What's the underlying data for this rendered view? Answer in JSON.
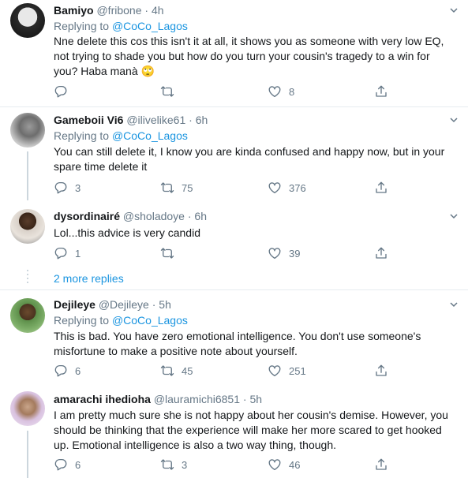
{
  "replying_label": "Replying to",
  "tweets": [
    {
      "name": "Bamiyo",
      "handle": "@fribone",
      "sep": "·",
      "time": "4h",
      "reply_to": "@CoCo_Lagos",
      "text": "Nne delete this cos this isn't it at all, it shows you as someone with very low EQ, not trying to shade you but how do you turn your cousin's tragedy to a win for you? Haba manà 🙄",
      "replies": "",
      "retweets": "",
      "likes": "8"
    },
    {
      "name": "Gameboii Vi6",
      "handle": "@ilivelike61",
      "sep": "·",
      "time": "6h",
      "reply_to": "@CoCo_Lagos",
      "text": "You can still delete it, I know you are kinda confused and happy now, but in your spare time delete it",
      "replies": "3",
      "retweets": "75",
      "likes": "376"
    },
    {
      "name": "dysordinairé",
      "handle": "@sholadoye",
      "sep": "·",
      "time": "6h",
      "reply_to": "",
      "text": "Lol...this advice is very candid",
      "replies": "1",
      "retweets": "",
      "likes": "39"
    },
    {
      "name": "Dejileye",
      "handle": "@Dejileye",
      "sep": "·",
      "time": "5h",
      "reply_to": "@CoCo_Lagos",
      "text": "This is bad. You have zero emotional intelligence. You don't use someone's misfortune to make a positive note about yourself.",
      "replies": "6",
      "retweets": "45",
      "likes": "251"
    },
    {
      "name": "amarachi ihedioha",
      "handle": "@lauramichi6851",
      "sep": "·",
      "time": "5h",
      "reply_to": "",
      "text": "I am pretty much sure she is not happy about her cousin's demise. However, you should be thinking that the experience will make her more scared to get hooked up. Emotional intelligence is also a two way thing, though.",
      "replies": "6",
      "retweets": "3",
      "likes": "46"
    }
  ],
  "more_replies": "2 more replies",
  "colors": {
    "accent": "#1b95e0",
    "muted": "#657786",
    "border": "#e6ecf0"
  }
}
